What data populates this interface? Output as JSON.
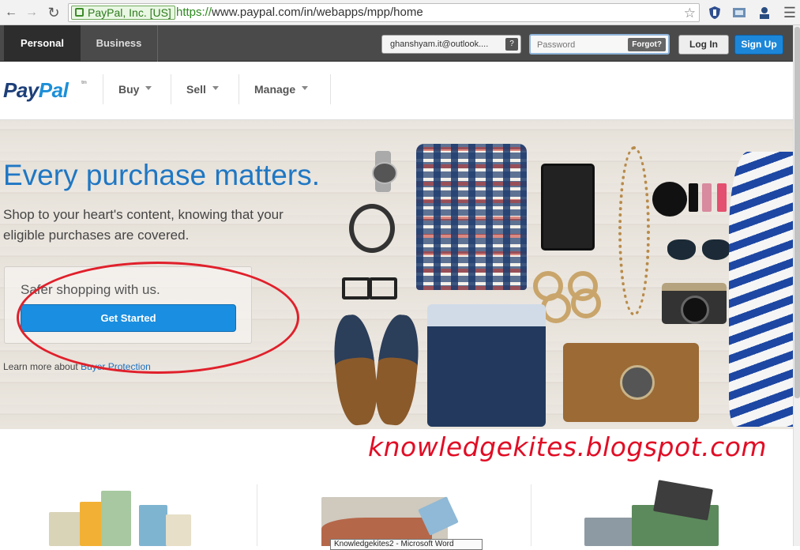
{
  "browser": {
    "ev_label": "PayPal, Inc. [US]",
    "url_scheme": "https://",
    "url_rest": "www.paypal.com/in/webapps/mpp/home"
  },
  "topbar": {
    "tabs": [
      "Personal",
      "Business"
    ],
    "email_value": "ghanshyam.it@outlook....",
    "email_help": "?",
    "password_placeholder": "Password",
    "forgot_label": "Forgot?",
    "login_label": "Log In",
    "signup_label": "Sign Up"
  },
  "nav": {
    "logo_pay": "Pay",
    "logo_pal": "Pal",
    "logo_tm": "tm",
    "items": [
      "Buy",
      "Sell",
      "Manage"
    ]
  },
  "hero": {
    "title": "Every purchase matters.",
    "subtitle": "Shop to your heart's content, knowing that your eligible purchases are covered.",
    "box_label": "Safer shopping with us.",
    "cta_label": "Get Started",
    "learn_prefix": "Learn more about",
    "learn_link": "Buyer Protection"
  },
  "watermark": "knowledgekites.blogspot.com",
  "tooltip": "Knowledgekites2 - Microsoft Word",
  "colors": {
    "brand_dark": "#1d3f79",
    "brand_light": "#1c8fd8",
    "annotation_red": "#e0202b"
  }
}
